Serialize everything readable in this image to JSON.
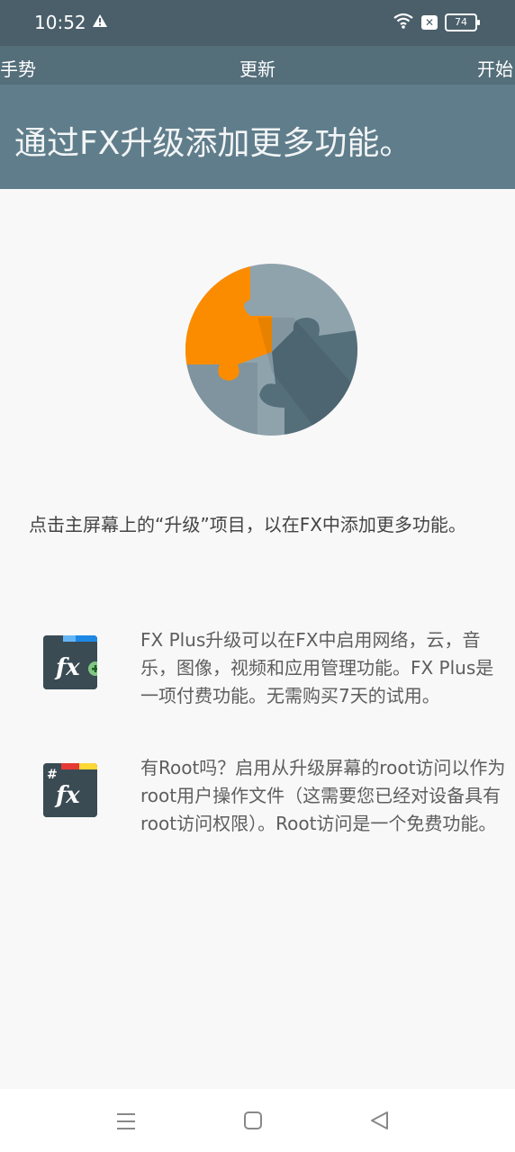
{
  "status_bar": {
    "time": "10:52",
    "battery": "74",
    "icons": [
      "alert-icon",
      "wifi-icon",
      "sim-x-icon",
      "battery-icon"
    ]
  },
  "tabs": {
    "left": "手势",
    "center": "更新",
    "right": "开始"
  },
  "header": {
    "title": "通过FX升级添加更多功能。"
  },
  "intro": "点击主屏幕上的“升级”项目，以在FX中添加更多功能。",
  "features": [
    {
      "icon": "fx-plus-icon",
      "text": "FX Plus升级可以在FX中启用网络，云，音乐，图像，视频和应用管理功能。FX Plus是一项付费功能。无需购买7天的试用。"
    },
    {
      "icon": "fx-root-icon",
      "text": "有Root吗？启用从升级屏幕的root访问以作为root用户操作文件（这需要您已经对设备具有root访问权限）。Root访问是一个免费功能。"
    }
  ],
  "hero_icon": "puzzle-icon",
  "nav": [
    "menu-icon",
    "home-icon",
    "back-icon"
  ],
  "colors": {
    "status_bar": "#4a5f69",
    "tab_bar": "#546e7a",
    "header": "#607d8b",
    "accent_orange": "#fb8c00",
    "background": "#f8f8f8"
  }
}
